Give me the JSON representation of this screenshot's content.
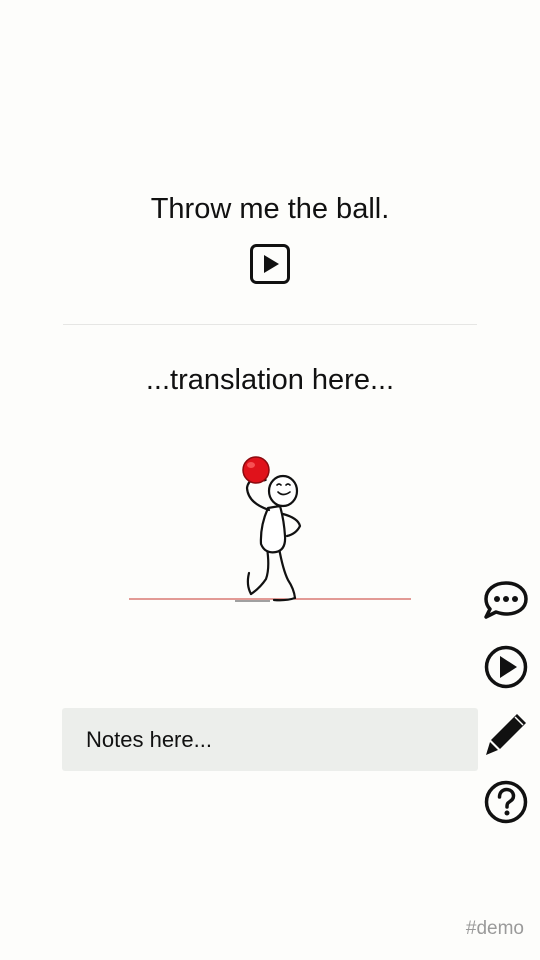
{
  "phrase": {
    "text": "Throw me the ball."
  },
  "translation": {
    "placeholder": "...translation here..."
  },
  "illustration": {
    "subject": "stick figure holding red ball",
    "ball_color": "#e0121b",
    "ground_color": "#c8372f"
  },
  "notes": {
    "placeholder": "Notes here..."
  },
  "side_toolbar": {
    "icons": [
      "chat-icon",
      "play-icon",
      "pencil-icon",
      "help-icon"
    ]
  },
  "footer": {
    "tag": "#demo"
  }
}
